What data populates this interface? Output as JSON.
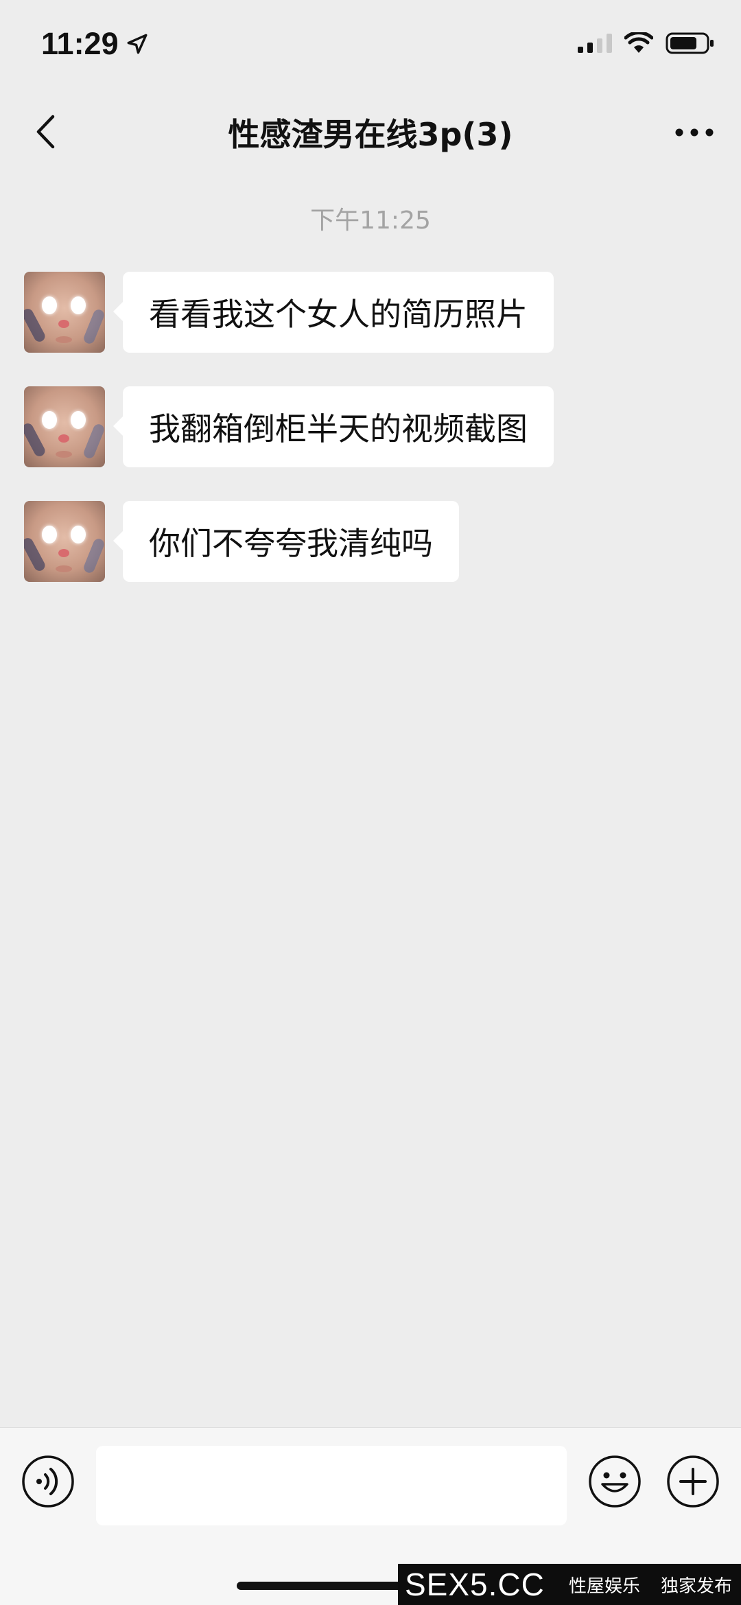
{
  "status_bar": {
    "time": "11:29",
    "icons": [
      "location-arrow-icon",
      "signal-icon",
      "wifi-icon",
      "battery-icon"
    ]
  },
  "nav": {
    "title": "性感渣男在线3p(3)",
    "back_icon": "chevron-left-icon",
    "more_icon": "more-dots-icon"
  },
  "chat": {
    "timestamp": "下午11:25",
    "messages": [
      {
        "text": "看看我这个女人的简历照片"
      },
      {
        "text": "我翻箱倒柜半天的视频截图"
      },
      {
        "text": "你们不夸夸我清纯吗"
      }
    ]
  },
  "input_bar": {
    "icons": [
      "voice-icon",
      "emoji-icon",
      "plus-icon"
    ],
    "text_value": ""
  },
  "watermark": {
    "site": "SEX5.CC",
    "tag1": "性屋娱乐",
    "tag2": "独家发布"
  },
  "colors": {
    "background": "#ededed",
    "bubble": "#ffffff",
    "timestamp": "#a3a3a3",
    "input_bar": "#f6f6f6"
  }
}
